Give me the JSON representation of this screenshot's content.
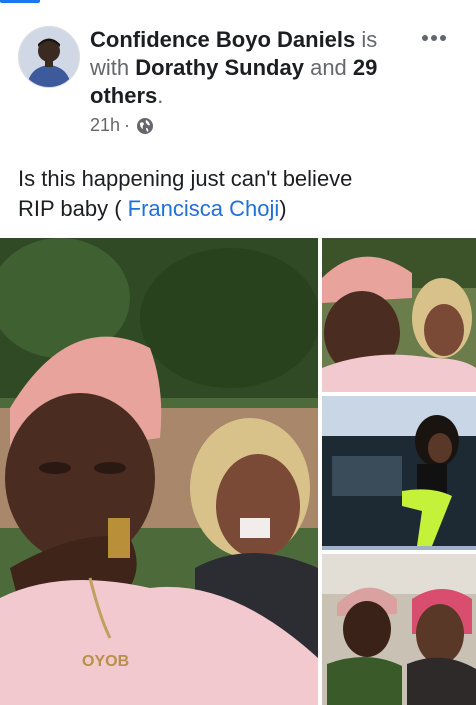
{
  "post": {
    "author": "Confidence Boyo Daniels",
    "with_text": "is with",
    "tagged_friend": "Dorathy Sunday",
    "and_text": "and",
    "others": "29 others",
    "time": "21h",
    "separator": "·",
    "privacy_icon": "globe-icon",
    "text_line1": "Is this happening just can't believe",
    "text_line2_prefix": "RIP baby (",
    "tagged_person": "Francisca Choji",
    "text_line2_suffix": ")"
  },
  "colors": {
    "link": "#216fdb",
    "secondary_text": "#65676b",
    "primary_text": "#1c1e21",
    "accent": "#1877f2"
  },
  "photos": {
    "count": 4,
    "shirt_text": "OYOB"
  }
}
